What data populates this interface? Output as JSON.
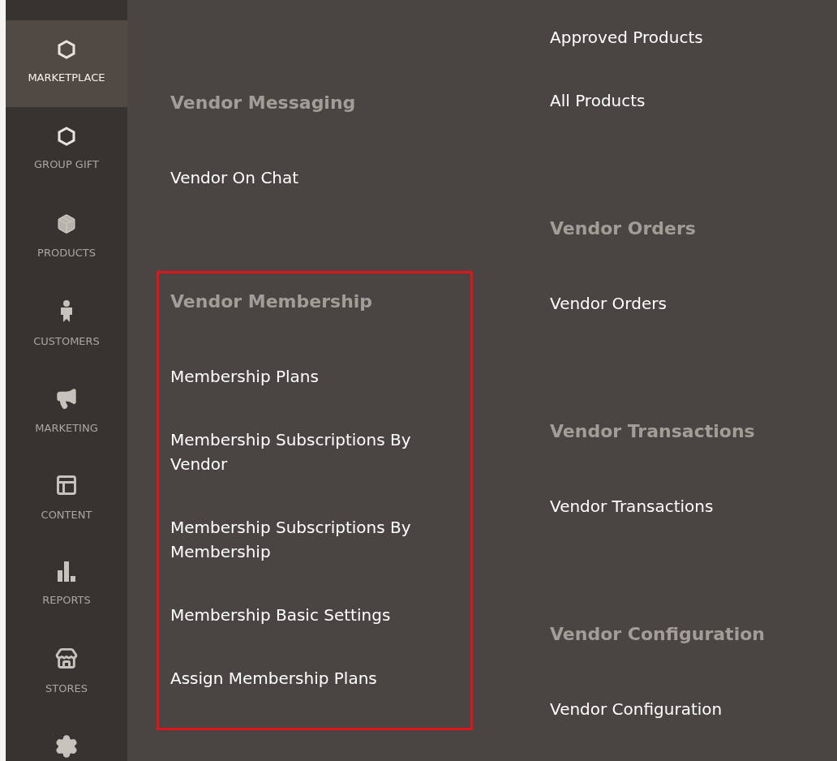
{
  "sidebar": {
    "items": [
      {
        "label": "MARKETPLACE",
        "kind": "hexagon",
        "selected": true
      },
      {
        "label": "GROUP GIFT",
        "kind": "hexagon",
        "selected": false
      },
      {
        "label": "PRODUCTS",
        "kind": "box",
        "selected": false
      },
      {
        "label": "CUSTOMERS",
        "kind": "person",
        "selected": false
      },
      {
        "label": "MARKETING",
        "kind": "megaphone",
        "selected": false
      },
      {
        "label": "CONTENT",
        "kind": "layout",
        "selected": false
      },
      {
        "label": "REPORTS",
        "kind": "bars",
        "selected": false
      },
      {
        "label": "STORES",
        "kind": "store",
        "selected": false
      },
      {
        "kind": "gear",
        "selected": false
      }
    ]
  },
  "menu": {
    "columns": [
      {
        "groups": [
          {
            "highlighted": false,
            "entries": [
              {
                "kind": "heading",
                "text": "Vendor Messaging"
              },
              {
                "kind": "link",
                "text": "Vendor On Chat"
              }
            ]
          },
          {
            "highlighted": true,
            "entries": [
              {
                "kind": "heading",
                "text": "Vendor Membership"
              },
              {
                "kind": "link",
                "text": "Membership Plans"
              },
              {
                "kind": "link",
                "text": "Membership Subscriptions By Vendor"
              },
              {
                "kind": "link",
                "text": "Membership Subscriptions By Membership"
              },
              {
                "kind": "link",
                "text": "Membership Basic Settings"
              },
              {
                "kind": "link",
                "text": "Assign Membership Plans"
              }
            ]
          }
        ]
      },
      {
        "groups": [
          {
            "highlighted": false,
            "entries": [
              {
                "kind": "link",
                "text": "Approved Products"
              },
              {
                "kind": "link",
                "text": "All Products"
              }
            ]
          },
          {
            "highlighted": false,
            "entries": [
              {
                "kind": "heading",
                "text": "Vendor Orders"
              },
              {
                "kind": "link",
                "text": "Vendor Orders"
              }
            ]
          },
          {
            "highlighted": false,
            "entries": [
              {
                "kind": "heading",
                "text": "Vendor Transactions"
              },
              {
                "kind": "link",
                "text": "Vendor Transactions"
              }
            ]
          },
          {
            "highlighted": false,
            "entries": [
              {
                "kind": "heading",
                "text": "Vendor Configuration"
              },
              {
                "kind": "link",
                "text": "Vendor Configuration"
              }
            ]
          }
        ]
      }
    ]
  }
}
